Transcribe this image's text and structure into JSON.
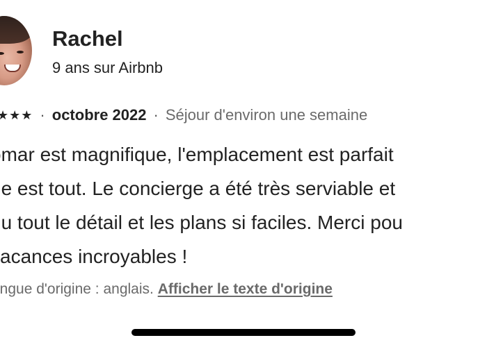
{
  "reviewer": {
    "name": "Rachel",
    "tenure": "9 ans sur Airbnb"
  },
  "review": {
    "stars": "★★★",
    "separator": "·",
    "date": "octobre 2022",
    "stay_duration": "Séjour d'environ une semaine",
    "lines": [
      "omar est magnifique, l'emplacement est parfait",
      "ue est tout. Le concierge a été très serviable et",
      "du tout le détail et les plans si faciles. Merci pou",
      "vacances incroyables !"
    ]
  },
  "translation": {
    "note": "angue d'origine : anglais.",
    "link_label": "Afficher le texte d'origine"
  },
  "icons": {
    "rating": "star-icon"
  }
}
